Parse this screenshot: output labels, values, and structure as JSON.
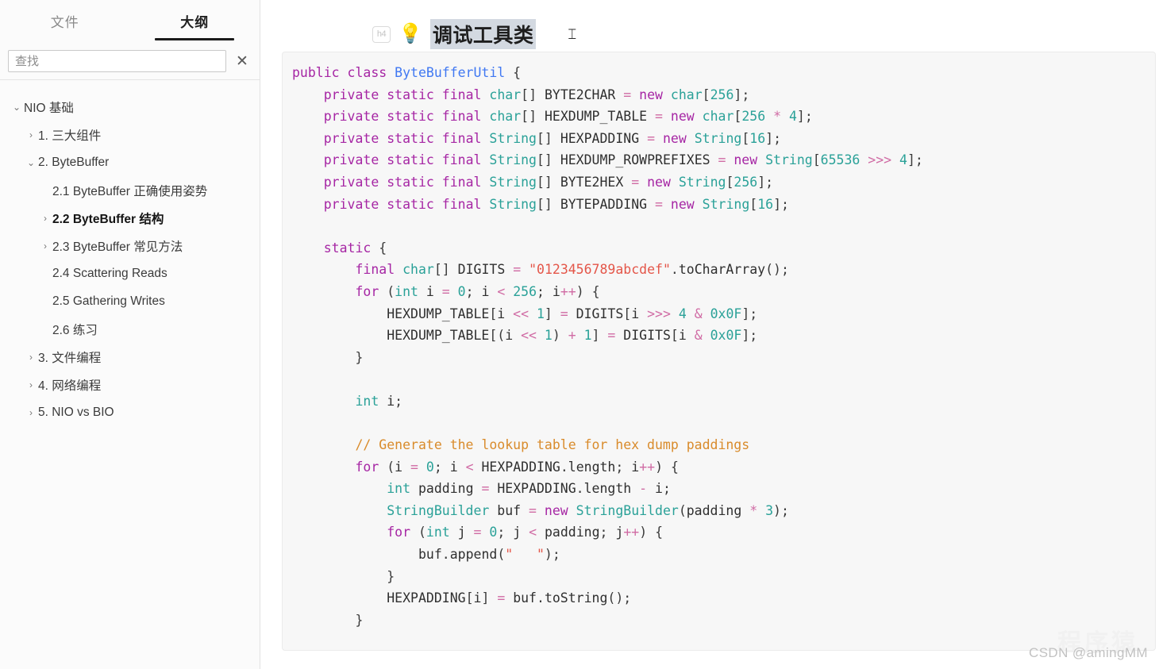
{
  "sidebar": {
    "tabs": [
      {
        "label": "文件",
        "active": false
      },
      {
        "label": "大纲",
        "active": true
      }
    ],
    "search": {
      "placeholder": "查找",
      "value": "",
      "clear_label": "✕"
    },
    "tree": [
      {
        "label": "NIO 基础",
        "level": 0,
        "chevron": "⌄",
        "bold": false
      },
      {
        "label": "1. 三大组件",
        "level": 1,
        "chevron": "›",
        "bold": false
      },
      {
        "label": "2. ByteBuffer",
        "level": 1,
        "chevron": "⌄",
        "bold": false
      },
      {
        "label": "2.1 ByteBuffer 正确使用姿势",
        "level": 2,
        "chevron": "",
        "bold": false
      },
      {
        "label": "2.2 ByteBuffer 结构",
        "level": 2,
        "chevron": "›",
        "bold": true
      },
      {
        "label": "2.3 ByteBuffer 常见方法",
        "level": 2,
        "chevron": "›",
        "bold": false
      },
      {
        "label": "2.4 Scattering Reads",
        "level": 2,
        "chevron": "",
        "bold": false
      },
      {
        "label": "2.5 Gathering Writes",
        "level": 2,
        "chevron": "",
        "bold": false
      },
      {
        "label": "2.6 练习",
        "level": 2,
        "chevron": "",
        "bold": false
      },
      {
        "label": "3. 文件编程",
        "level": 1,
        "chevron": "›",
        "bold": false
      },
      {
        "label": "4. 网络编程",
        "level": 1,
        "chevron": "›",
        "bold": false
      },
      {
        "label": "5. NIO vs BIO",
        "level": 1,
        "chevron": "›",
        "bold": false
      }
    ]
  },
  "editor": {
    "heading_level_badge": "h4",
    "heading_icon": "💡",
    "heading_text": "调试工具类",
    "heading_selected": true,
    "cursor_glyph": "⌶",
    "language": "java",
    "code_lines": [
      "public class ByteBufferUtil {",
      "    private static final char[] BYTE2CHAR = new char[256];",
      "    private static final char[] HEXDUMP_TABLE = new char[256 * 4];",
      "    private static final String[] HEXPADDING = new String[16];",
      "    private static final String[] HEXDUMP_ROWPREFIXES = new String[65536 >>> 4];",
      "    private static final String[] BYTE2HEX = new String[256];",
      "    private static final String[] BYTEPADDING = new String[16];",
      "",
      "    static {",
      "        final char[] DIGITS = \"0123456789abcdef\".toCharArray();",
      "        for (int i = 0; i < 256; i++) {",
      "            HEXDUMP_TABLE[i << 1] = DIGITS[i >>> 4 & 0x0F];",
      "            HEXDUMP_TABLE[(i << 1) + 1] = DIGITS[i & 0x0F];",
      "        }",
      "",
      "        int i;",
      "",
      "        // Generate the lookup table for hex dump paddings",
      "        for (i = 0; i < HEXPADDING.length; i++) {",
      "            int padding = HEXPADDING.length - i;",
      "            StringBuilder buf = new StringBuilder(padding * 3);",
      "            for (int j = 0; j < padding; j++) {",
      "                buf.append(\"   \");",
      "            }",
      "            HEXPADDING[i] = buf.toString();",
      "        }"
    ]
  },
  "watermark": {
    "text": "CSDN @amingMM",
    "ghost": "程序猿"
  },
  "colors": {
    "accent": "#1b1b1b",
    "selection": "#d3d9e1",
    "code_bg": "#f7f7f7",
    "sidebar_bg": "#fbfbfb",
    "keyword": "#a626a4",
    "type": "#2aa198",
    "class_name": "#4078f2",
    "string": "#e45649",
    "comment": "#d98b2b",
    "operator": "#d06ba4"
  }
}
